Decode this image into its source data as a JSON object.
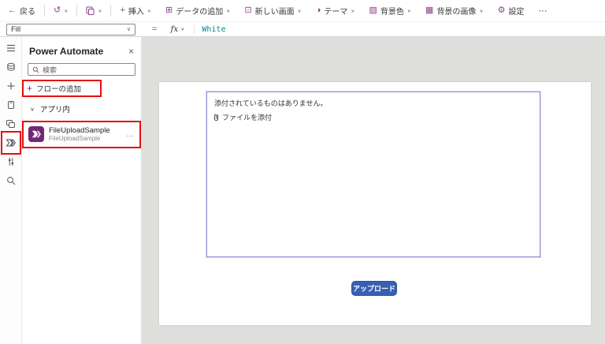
{
  "icons": {
    "back": "←",
    "undo": "↺",
    "chevron_down": "∨",
    "more_h": "⋯",
    "close": "×",
    "flow_more": "…",
    "plus": "+"
  },
  "toolbar": {
    "back_label": "戻る",
    "groups": [
      {
        "icon": "+",
        "label": "挿入"
      },
      {
        "icon": "⊞",
        "label": "データの追加"
      },
      {
        "icon": "⊡",
        "label": "新しい画面"
      },
      {
        "icon": "◑",
        "label": "テーマ"
      },
      {
        "icon": "▧",
        "label": "背景色"
      },
      {
        "icon": "▦",
        "label": "背景の画像"
      },
      {
        "icon": "⚙",
        "label": "設定"
      }
    ]
  },
  "formula_bar": {
    "property": "Fill",
    "equals": "=",
    "fx_label": "fx",
    "formula": "White"
  },
  "rail": {
    "icons": [
      "tree-view-icon",
      "data-icon",
      "insert-icon",
      "media-icon",
      "screens-icon",
      "power-automate-icon",
      "variables-icon",
      "search-icon"
    ]
  },
  "panel": {
    "title": "Power Automate",
    "search_placeholder": "検索",
    "add_flow_label": "フローの追加",
    "section_label": "アプリ内",
    "flow": {
      "name": "FileUploadSample",
      "subtitle": "FileUploadSample"
    }
  },
  "canvas": {
    "attachment": {
      "empty_text": "添付されているものはありません。",
      "attach_link": "ファイルを添付"
    },
    "upload_button_label": "アップロード"
  },
  "colors": {
    "accent_purple": "#742774",
    "toolbar_icon_purple": "#8f3e8c",
    "formula_teal": "#0f8387",
    "upload_blue": "#3860b2",
    "annotation_red": "#e40f0f",
    "canvas_gray": "#dfdfde",
    "attachment_border": "#8e92d8"
  }
}
